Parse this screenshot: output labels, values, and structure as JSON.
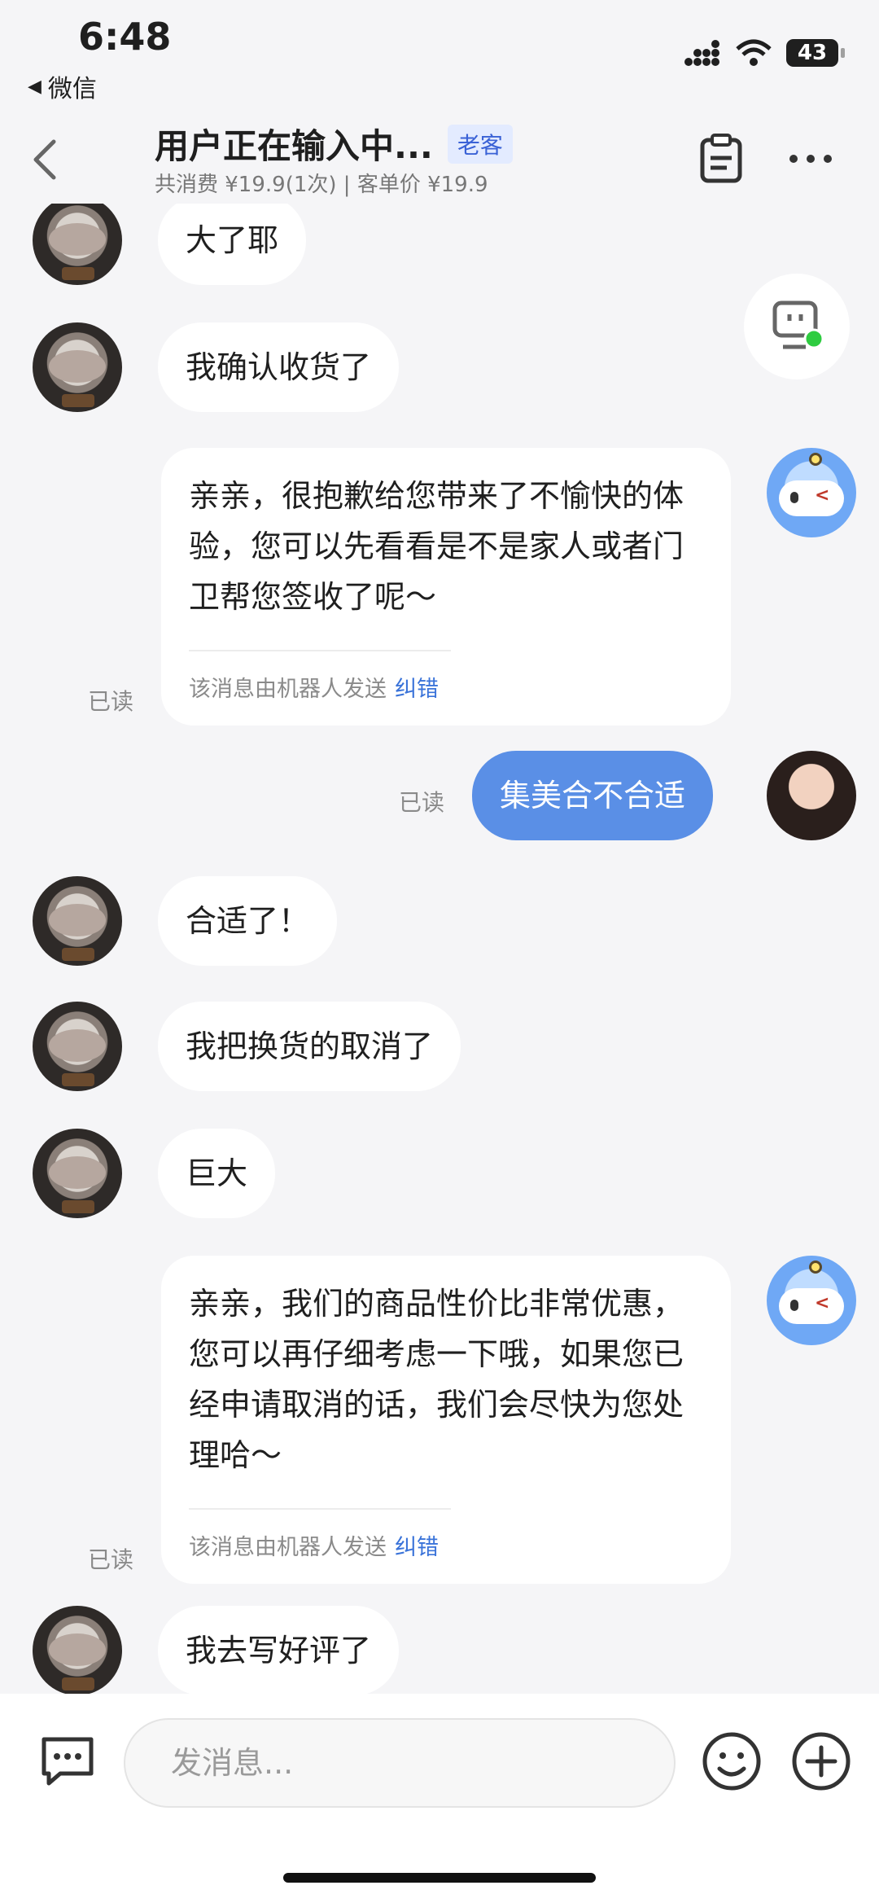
{
  "status_bar": {
    "time": "6:48",
    "back_app": "微信",
    "battery": "43"
  },
  "header": {
    "title": "用户正在输入中...",
    "tag": "老客",
    "subtitle": "共消费 ¥19.9(1次) | 客单价 ¥19.9"
  },
  "messages": [
    {
      "from": "customer",
      "text": "大了耶"
    },
    {
      "from": "customer",
      "text": "我确认收货了"
    },
    {
      "from": "bot",
      "text": "亲亲，很抱歉给您带来了不愉快的体验，您可以先看看是不是家人或者门卫帮您签收了呢～",
      "meta": "该消息由机器人发送",
      "fix": "纠错",
      "read": "已读"
    },
    {
      "from": "agent",
      "text": "集美合不合适",
      "read": "已读"
    },
    {
      "from": "customer",
      "text": "合适了！"
    },
    {
      "from": "customer",
      "text": "我把换货的取消了"
    },
    {
      "from": "customer",
      "text": "巨大"
    },
    {
      "from": "bot",
      "text": "亲亲，我们的商品性价比非常优惠，您可以再仔细考虑一下哦，如果您已经申请取消的话，我们会尽快为您处理哈～",
      "meta": "该消息由机器人发送",
      "fix": "纠错",
      "read": "已读"
    },
    {
      "from": "customer",
      "text": "我去写好评了"
    }
  ],
  "input": {
    "placeholder": "发消息..."
  },
  "colors": {
    "accent": "#5a8fe6",
    "link": "#3a73d9",
    "tag_bg": "#e3ebff"
  }
}
